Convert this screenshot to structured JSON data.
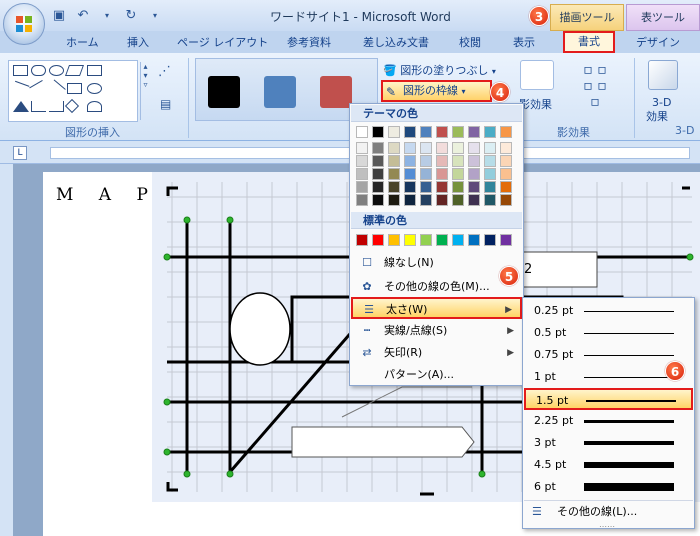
{
  "window": {
    "title": "ワードサイト1 - Microsoft Word"
  },
  "qat": {
    "icons": [
      "save-icon",
      "undo-icon",
      "redo-icon"
    ]
  },
  "contextual_tabs": {
    "drawing": "描画ツール",
    "table": "表ツール"
  },
  "tabs": [
    "ホーム",
    "挿入",
    "ページ レイアウト",
    "参考資料",
    "差し込み文書",
    "校閲",
    "表示",
    "書式",
    "デザイン"
  ],
  "ribbon": {
    "groups": {
      "insert_shapes": "図形の挿入",
      "shadow": "影効果",
      "threed": "3-D"
    },
    "fill_label": "図形の塗りつぶし",
    "outline_label": "図形の枠線",
    "shadow_btn": "影効果",
    "threed_btn": "3-D",
    "threed_sub": "効果"
  },
  "styles": {
    "swatches": [
      "#000000",
      "#4f81bd",
      "#c0504d"
    ]
  },
  "badges": [
    "3",
    "4",
    "5",
    "6"
  ],
  "document": {
    "text": "M A P",
    "fragment": "2"
  },
  "dropdown": {
    "theme_header": "テーマの色",
    "theme_colors": [
      [
        "#ffffff",
        "#000000",
        "#eeece1",
        "#1f497d",
        "#4f81bd",
        "#c0504d",
        "#9bbb59",
        "#8064a2",
        "#4bacc6",
        "#f79646"
      ],
      [
        "#f2f2f2",
        "#7f7f7f",
        "#ddd9c3",
        "#c6d9f0",
        "#dbe5f1",
        "#f2dcdb",
        "#ebf1dd",
        "#e5e0ec",
        "#dbeef3",
        "#fdeada"
      ],
      [
        "#d8d8d8",
        "#595959",
        "#c4bd97",
        "#8db3e2",
        "#b8cce4",
        "#e5b9b7",
        "#d7e3bc",
        "#ccc1d9",
        "#b7dde8",
        "#fbd5b5"
      ],
      [
        "#bfbfbf",
        "#3f3f3f",
        "#938953",
        "#548dd4",
        "#95b3d7",
        "#d99694",
        "#c3d69b",
        "#b2a2c7",
        "#92cddc",
        "#fac08f"
      ],
      [
        "#a5a5a5",
        "#262626",
        "#494429",
        "#17365d",
        "#366092",
        "#953734",
        "#76923c",
        "#5f497a",
        "#31859b",
        "#e36c09"
      ],
      [
        "#7f7f7f",
        "#0c0c0c",
        "#1d1b10",
        "#0f243e",
        "#244061",
        "#632423",
        "#4f6128",
        "#3f3151",
        "#205867",
        "#974806"
      ]
    ],
    "standard_header": "標準の色",
    "standard_colors": [
      "#c00000",
      "#ff0000",
      "#ffc000",
      "#ffff00",
      "#92d050",
      "#00b050",
      "#00b0f0",
      "#0070c0",
      "#002060",
      "#7030a0"
    ],
    "no_line": "線なし(N)",
    "more_colors": "その他の線の色(M)...",
    "weight": "太さ(W)",
    "dashes": "実線/点線(S)",
    "arrows": "矢印(R)",
    "pattern": "パターン(A)..."
  },
  "weights": [
    {
      "label": "0.25 pt",
      "w": 0.25
    },
    {
      "label": "0.5 pt",
      "w": 0.5
    },
    {
      "label": "0.75 pt",
      "w": 0.75
    },
    {
      "label": "1 pt",
      "w": 1
    },
    {
      "label": "1.5 pt",
      "w": 1.5
    },
    {
      "label": "2.25 pt",
      "w": 2.25
    },
    {
      "label": "3 pt",
      "w": 3
    },
    {
      "label": "4.5 pt",
      "w": 4.5
    },
    {
      "label": "6 pt",
      "w": 6
    }
  ],
  "more_lines": "その他の線(L)..."
}
